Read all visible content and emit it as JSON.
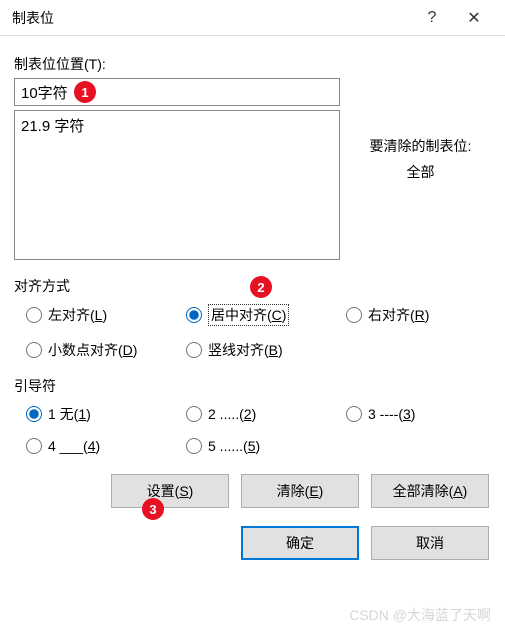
{
  "titlebar": {
    "title": "制表位",
    "help": "?",
    "close": "✕"
  },
  "labels": {
    "position": "制表位位置(T):",
    "clear_hint1": "要清除的制表位:",
    "clear_hint2": "全部",
    "alignment": "对齐方式",
    "leader": "引导符"
  },
  "input": {
    "value": "10字符"
  },
  "list": {
    "items": [
      "21.9 字符"
    ]
  },
  "alignment": {
    "options": [
      {
        "label": "左对齐(L)",
        "key": "L"
      },
      {
        "label": "居中对齐(C)",
        "key": "C"
      },
      {
        "label": "右对齐(R)",
        "key": "R"
      },
      {
        "label": "小数点对齐(D)",
        "key": "D"
      },
      {
        "label": "竖线对齐(B)",
        "key": "B"
      }
    ],
    "selected": 1
  },
  "leader": {
    "options": [
      {
        "label": "1 无(1)",
        "key": "1"
      },
      {
        "label": "2 .....(2)",
        "key": "2"
      },
      {
        "label": "3 ----(3)",
        "key": "3"
      },
      {
        "label": "4 ___(4)",
        "key": "4"
      },
      {
        "label": "5 ......(5)",
        "key": "5"
      }
    ],
    "selected": 0
  },
  "buttons": {
    "set": "设置(S)",
    "clear": "清除(E)",
    "clearall": "全部清除(A)",
    "ok": "确定",
    "cancel": "取消"
  },
  "markers": {
    "m1": "1",
    "m2": "2",
    "m3": "3"
  },
  "watermark": "CSDN @大海蓝了天啊"
}
